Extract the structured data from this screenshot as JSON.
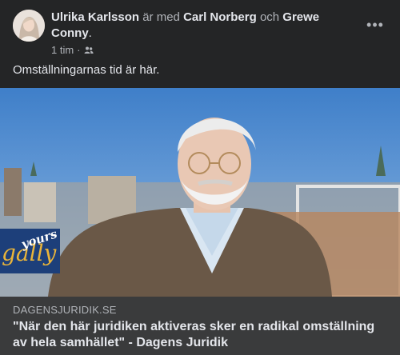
{
  "post": {
    "author": "Ulrika Karlsson",
    "with_text": "är med",
    "tagged1": "Carl Norberg",
    "and_text": "och",
    "tagged2": "Grewe Conny",
    "period": ".",
    "time": "1 tim",
    "separator": "·",
    "audience_icon": "friends-icon",
    "more_icon": "more-options-icon",
    "more_label": "•••",
    "caption": "Omställningarnas tid är här."
  },
  "link": {
    "domain": "DAGENSJURIDIK.SE",
    "title": "\"När den här juridiken aktiveras sker en radikal omställning av hela samhället\" - Dagens Juridik",
    "logo_text1": "gally",
    "logo_text2": "yours"
  },
  "colors": {
    "background": "#242526",
    "link_bar": "#3a3b3c",
    "text_primary": "#e4e6eb",
    "text_secondary": "#b0b3b8"
  }
}
